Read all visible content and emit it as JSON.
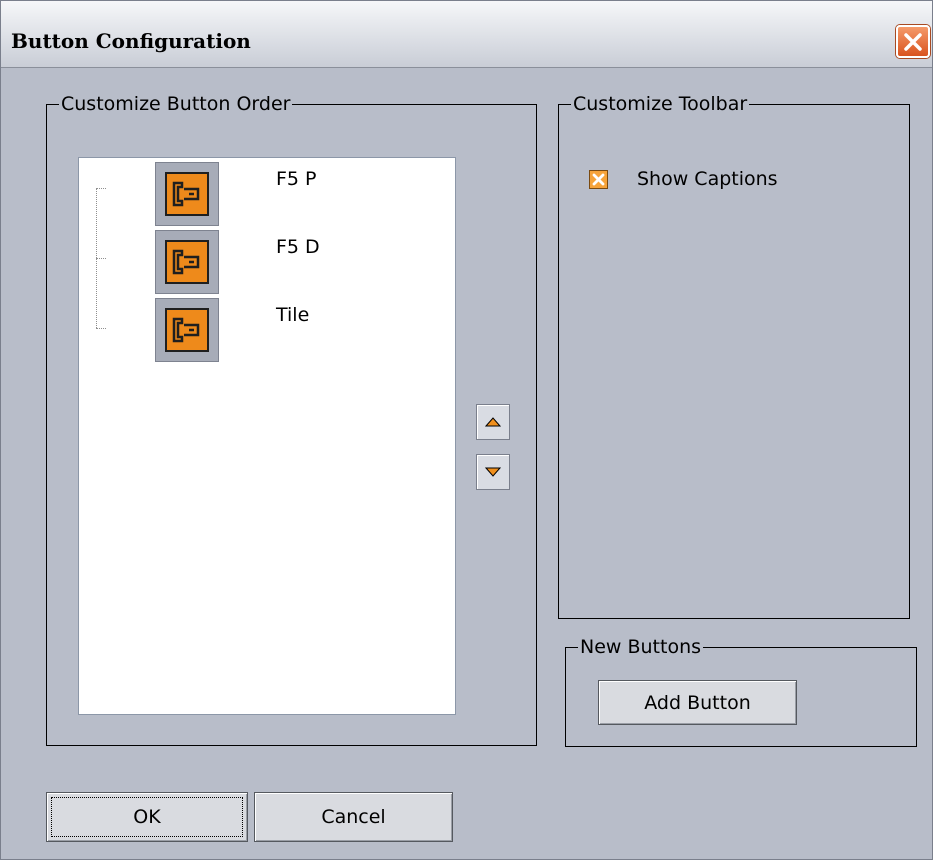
{
  "window": {
    "title": "Button Configuration",
    "close_icon": "close-icon"
  },
  "order_group": {
    "legend": "Customize Button Order",
    "items": [
      {
        "label": "F5 P",
        "icon": "button-icon"
      },
      {
        "label": "F5 D",
        "icon": "button-icon"
      },
      {
        "label": "Tile",
        "icon": "button-icon"
      }
    ],
    "move_up_icon": "arrow-up-icon",
    "move_down_icon": "arrow-down-icon"
  },
  "toolbar_group": {
    "legend": "Customize Toolbar",
    "show_captions_label": "Show Captions",
    "show_captions_checked": true
  },
  "new_buttons_group": {
    "legend": "New Buttons",
    "add_button_label": "Add Button"
  },
  "footer": {
    "ok_label": "OK",
    "cancel_label": "Cancel"
  },
  "colors": {
    "window_bg": "#b8bdc9",
    "accent_orange": "#ee8a1b",
    "close_red": "#d9531e"
  }
}
